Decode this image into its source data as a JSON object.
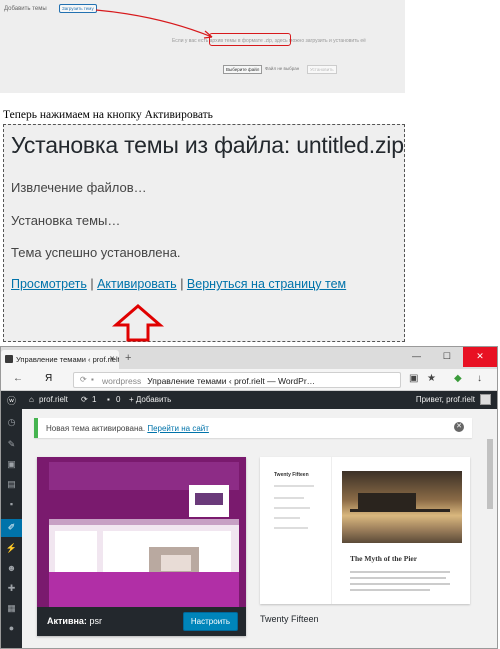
{
  "top_shot": {
    "add_theme": "Добавить темы",
    "upload_button": "Загрузить тему",
    "hint_text": "Если у вас есть архив темы в формате .zip, здесь можно загрузить и установить её",
    "choose_file": "Выберите файл",
    "no_file": "Файл не выбран",
    "install_now": "Установить"
  },
  "instruction": "Теперь нажимаем на кнопку Активировать",
  "install": {
    "title": "Установка темы из файла: untitled.zip",
    "step1": "Извлечение файлов…",
    "step2": "Установка темы…",
    "step3": "Тема успешно установлена.",
    "link_preview": "Просмотреть",
    "link_activate": "Активировать",
    "link_back": "Вернуться на страницу тем",
    "separator": "|"
  },
  "browser": {
    "tab_title": "Управление темами ‹ prof.rielt",
    "tab_close": "✕",
    "new_tab": "+",
    "win_minimize": "—",
    "win_maximize": "☐",
    "win_close": "✕",
    "back_icon": "←",
    "yandex_logo": "Я",
    "address_domain": "wordpress",
    "address_title": "Управление темами ‹ prof.rielt — WordPr…",
    "download_icon": "↓",
    "bookmark_icon": "★"
  },
  "adminbar": {
    "site_name": "prof.rielt",
    "updates_count": "1",
    "comments_count": "0",
    "add_new": "+ Добавить",
    "greeting": "Привет, prof.rielt"
  },
  "notice": {
    "text": "Новая тема активирована.",
    "link": "Перейти на сайт",
    "dismiss": "✕"
  },
  "active_theme": {
    "prefix": "Активна:",
    "name": "psr",
    "customize": "Настроить"
  },
  "theme2": {
    "name": "Twenty Fifteen",
    "side_title": "Twenty Fifteen",
    "post_title": "The Myth of the Pier"
  },
  "colors": {
    "admin_dark": "#23282d",
    "wp_blue": "#0073aa",
    "primary_button": "#0085ba",
    "notice_green": "#46b450",
    "annotation_red": "#d7191c"
  }
}
